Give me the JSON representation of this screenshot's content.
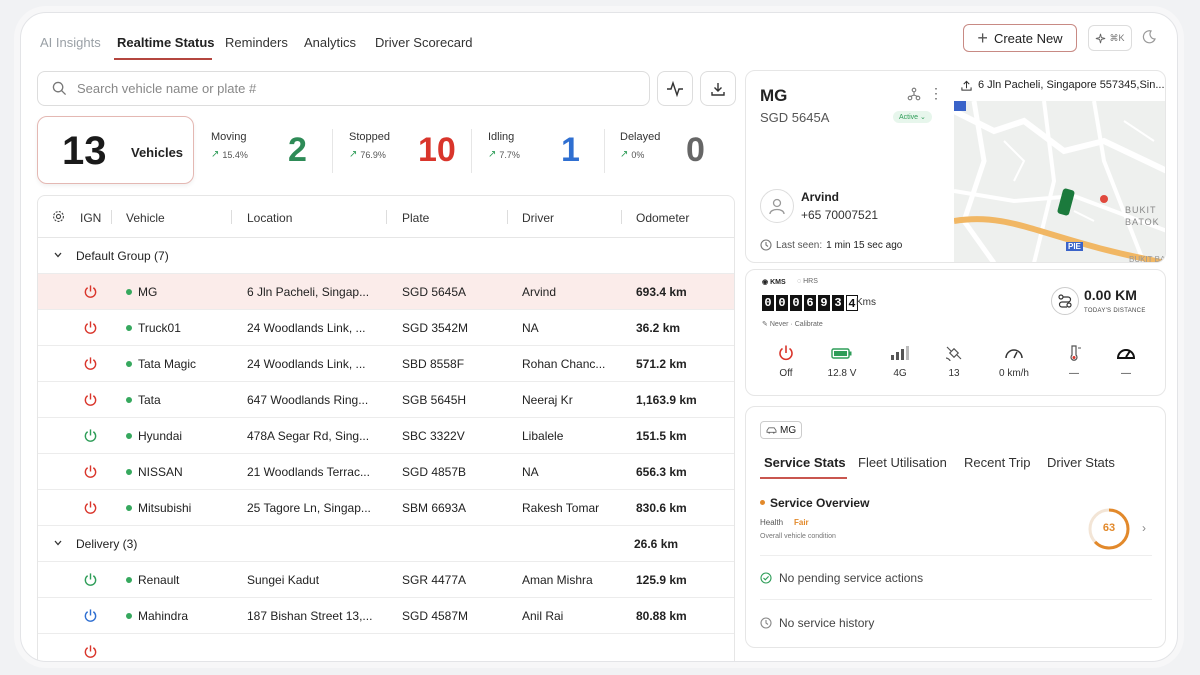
{
  "nav": {
    "tabs": [
      {
        "label": "AI Insights"
      },
      {
        "label": "Realtime Status"
      },
      {
        "label": "Reminders"
      },
      {
        "label": "Analytics"
      },
      {
        "label": "Driver Scorecard"
      }
    ],
    "create_label": "Create New",
    "shortcut_label": "⌘K"
  },
  "search": {
    "placeholder": "Search vehicle name or plate #"
  },
  "summary": {
    "total": "13",
    "total_label": "Vehicles",
    "stats": [
      {
        "name": "Moving",
        "pct": "15.4%",
        "value": "2",
        "color": "#2e8b57"
      },
      {
        "name": "Stopped",
        "pct": "76.9%",
        "value": "10",
        "color": "#d9352b"
      },
      {
        "name": "Idling",
        "pct": "7.7%",
        "value": "1",
        "color": "#2f6fd1"
      },
      {
        "name": "Delayed",
        "pct": "0%",
        "value": "0",
        "color": "#666666"
      }
    ]
  },
  "table": {
    "headers": {
      "ign": "IGN",
      "vehicle": "Vehicle",
      "location": "Location",
      "plate": "Plate",
      "driver": "Driver",
      "odometer": "Odometer"
    },
    "groups": [
      {
        "label": "Default Group (7)",
        "odometer": ""
      },
      {
        "label": "Delivery (3)",
        "odometer": "26.6 km"
      }
    ],
    "rows": [
      {
        "ign": "off",
        "vehicle": "MG",
        "location": "6 Jln Pacheli, Singap...",
        "plate": "SGD 5645A",
        "driver": "Arvind",
        "odometer": "693.4 km"
      },
      {
        "ign": "off",
        "vehicle": "Truck01",
        "location": "24 Woodlands Link, ...",
        "plate": "SGD 3542M",
        "driver": "NA",
        "odometer": "36.2 km"
      },
      {
        "ign": "off",
        "vehicle": "Tata Magic",
        "location": "24 Woodlands Link, ...",
        "plate": "SBD 8558F",
        "driver": "Rohan Chanc...",
        "odometer": "571.2 km"
      },
      {
        "ign": "off",
        "vehicle": "Tata",
        "location": "647 Woodlands Ring...",
        "plate": "SGB 5645H",
        "driver": "Neeraj Kr",
        "odometer": "1,163.9 km"
      },
      {
        "ign": "on",
        "vehicle": "Hyundai",
        "location": "478A Segar Rd, Sing...",
        "plate": "SBC 3322V",
        "driver": "Libalele",
        "odometer": "151.5 km"
      },
      {
        "ign": "off",
        "vehicle": "NISSAN",
        "location": "21 Woodlands Terrac...",
        "plate": "SGD 4857B",
        "driver": "NA",
        "odometer": "656.3 km"
      },
      {
        "ign": "off",
        "vehicle": "Mitsubishi",
        "location": "25 Tagore Ln, Singap...",
        "plate": "SBM 6693A",
        "driver": "Rakesh Tomar",
        "odometer": "830.6 km"
      },
      {
        "ign": "on",
        "vehicle": "Renault",
        "location": "Sungei Kadut",
        "plate": "SGR 4477A",
        "driver": "Aman Mishra",
        "odometer": "125.9 km"
      },
      {
        "ign": "idle",
        "vehicle": "Mahindra",
        "location": "187 Bishan Street 13,...",
        "plate": "SGD 4587M",
        "driver": "Anil Rai",
        "odometer": "80.88 km"
      }
    ]
  },
  "vehicle_card": {
    "name": "MG",
    "plate": "SGD 5645A",
    "status": "Active",
    "address": "6 Jln Pacheli, Singapore 557345,Sin...",
    "driver_name": "Arvind",
    "driver_phone": "+65 70007521",
    "last_seen_label": "Last seen:",
    "last_seen_value": "1 min 15 sec ago",
    "map_labels": {
      "pie": "PIE",
      "bukit": "BUKIT",
      "batok": "BATOK",
      "bukit2": "BUKIT BA"
    }
  },
  "odometer_card": {
    "unit_kms": "KMS",
    "unit_hrs": "HRS",
    "digits": [
      "0",
      "0",
      "0",
      "6",
      "9",
      "3",
      "4"
    ],
    "unit": "Kms",
    "calibrate_never": "Never",
    "calibrate_label": "Calibrate",
    "today_value": "0.00 KM",
    "today_label": "TODAY'S DISTANCE",
    "sensors": [
      {
        "icon": "power-icon",
        "value": "Off"
      },
      {
        "icon": "battery-icon",
        "value": "12.8 V"
      },
      {
        "icon": "signal-icon",
        "value": "4G"
      },
      {
        "icon": "satellite-icon",
        "value": "13"
      },
      {
        "icon": "speedometer-icon",
        "value": "0 km/h"
      },
      {
        "icon": "thermometer-icon",
        "value": "—"
      },
      {
        "icon": "gauge-icon",
        "value": "—"
      }
    ]
  },
  "stats_card": {
    "chip": "MG",
    "tabs": [
      {
        "label": "Service Stats"
      },
      {
        "label": "Fleet Utilisation"
      },
      {
        "label": "Recent Trip"
      },
      {
        "label": "Driver Stats"
      }
    ],
    "overview_title": "Service Overview",
    "health_label": "Health",
    "health_value": "Fair",
    "condition_label": "Overall vehicle condition",
    "score": "63",
    "score_value": 0.63,
    "pending": "No pending service actions",
    "history": "No service history"
  }
}
